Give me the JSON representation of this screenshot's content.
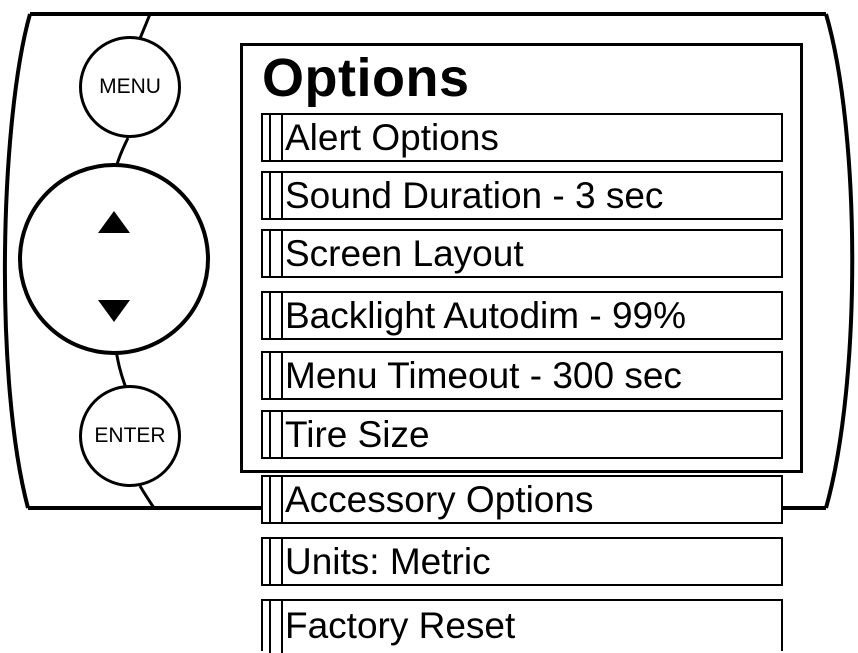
{
  "device": {
    "menu_button": "MENU",
    "enter_button": "ENTER",
    "up_arrow_icon": "up-triangle-icon",
    "down_arrow_icon": "down-triangle-icon"
  },
  "screen": {
    "title": "Options",
    "items": [
      {
        "label": "Alert Options"
      },
      {
        "label": "Sound Duration - 3 sec"
      },
      {
        "label": "Screen Layout"
      },
      {
        "label": "Backlight Autodim - 99%"
      },
      {
        "label": "Menu Timeout - 300 sec"
      },
      {
        "label": "Tire Size"
      },
      {
        "label": "Accessory Options"
      },
      {
        "label": "Units: Metric"
      },
      {
        "label": "Factory Reset"
      }
    ]
  }
}
